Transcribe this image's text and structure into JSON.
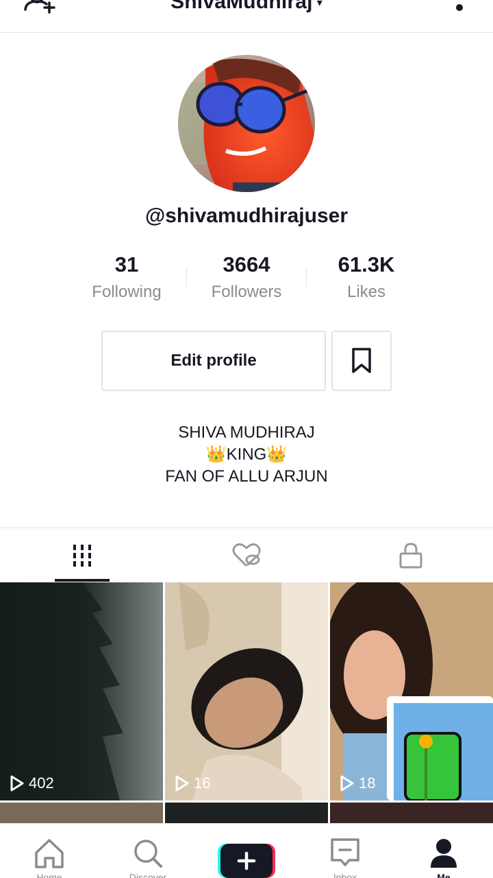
{
  "header": {
    "title": "ShivaMudhiraj",
    "caret": "▾"
  },
  "profile": {
    "username": "@shivamudhirajuser",
    "stats": [
      {
        "value": "31",
        "label": "Following"
      },
      {
        "value": "3664",
        "label": "Followers"
      },
      {
        "value": "61.3K",
        "label": "Likes"
      }
    ],
    "edit_label": "Edit profile",
    "bio": [
      "SHIVA MUDHIRAJ",
      "👑KING👑",
      "FAN OF ALLU ARJUN"
    ]
  },
  "tabs": [
    {
      "name": "videos",
      "icon": "grid-icon",
      "active": true
    },
    {
      "name": "liked",
      "icon": "hidden-heart-icon",
      "active": false
    },
    {
      "name": "private",
      "icon": "lock-icon",
      "active": false
    }
  ],
  "videos": [
    {
      "views": "402"
    },
    {
      "views": "16"
    },
    {
      "views": "18"
    }
  ],
  "bottom_nav": [
    {
      "label": "Home",
      "icon": "home-icon"
    },
    {
      "label": "Discover",
      "icon": "search-icon"
    },
    {
      "label": "",
      "icon": "create-icon"
    },
    {
      "label": "Inbox",
      "icon": "inbox-icon"
    },
    {
      "label": "Me",
      "icon": "profile-icon"
    }
  ],
  "colors": {
    "text": "#161823",
    "secondary": "#8a8b91",
    "border": "#e3e3e4",
    "create_cyan": "#25f4ee",
    "create_pink": "#fe2c55"
  }
}
